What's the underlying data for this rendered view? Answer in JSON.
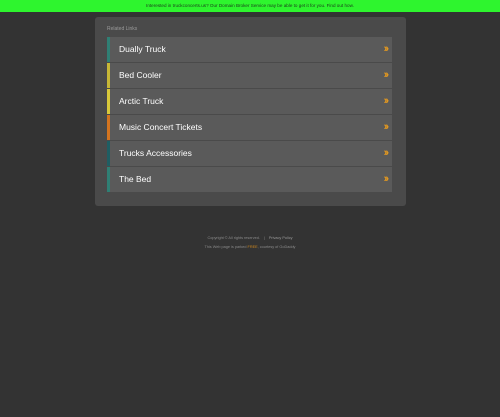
{
  "banner": {
    "text": "Interested in truckconcerts.us? Our Domain Broker Service may be able to get it for you. Find out how."
  },
  "panel": {
    "heading": "Related Links",
    "links": [
      {
        "label": "Dually Truck",
        "accent": "#2f7f74"
      },
      {
        "label": "Bed Cooler",
        "accent": "#c7b736"
      },
      {
        "label": "Arctic Truck",
        "accent": "#d8c83a"
      },
      {
        "label": "Music Concert Tickets",
        "accent": "#d3741f"
      },
      {
        "label": "Trucks Accessories",
        "accent": "#1f5e63"
      },
      {
        "label": "The Bed",
        "accent": "#2f7f74"
      }
    ],
    "chevron_icon": "double-chevron-right-icon",
    "chevron_color": "#e69a1f"
  },
  "footer": {
    "copyright": "Copyright © All rights reserved.",
    "privacy": "Privacy Policy",
    "parked_prefix": "This Web page is parked",
    "parked_link": "FREE",
    "parked_suffix": ", courtesy of GoDaddy"
  },
  "colors": {
    "background": "#333333",
    "banner": "#2ef52e",
    "panel": "#4a4a4a",
    "row": "#5a5a5a"
  }
}
